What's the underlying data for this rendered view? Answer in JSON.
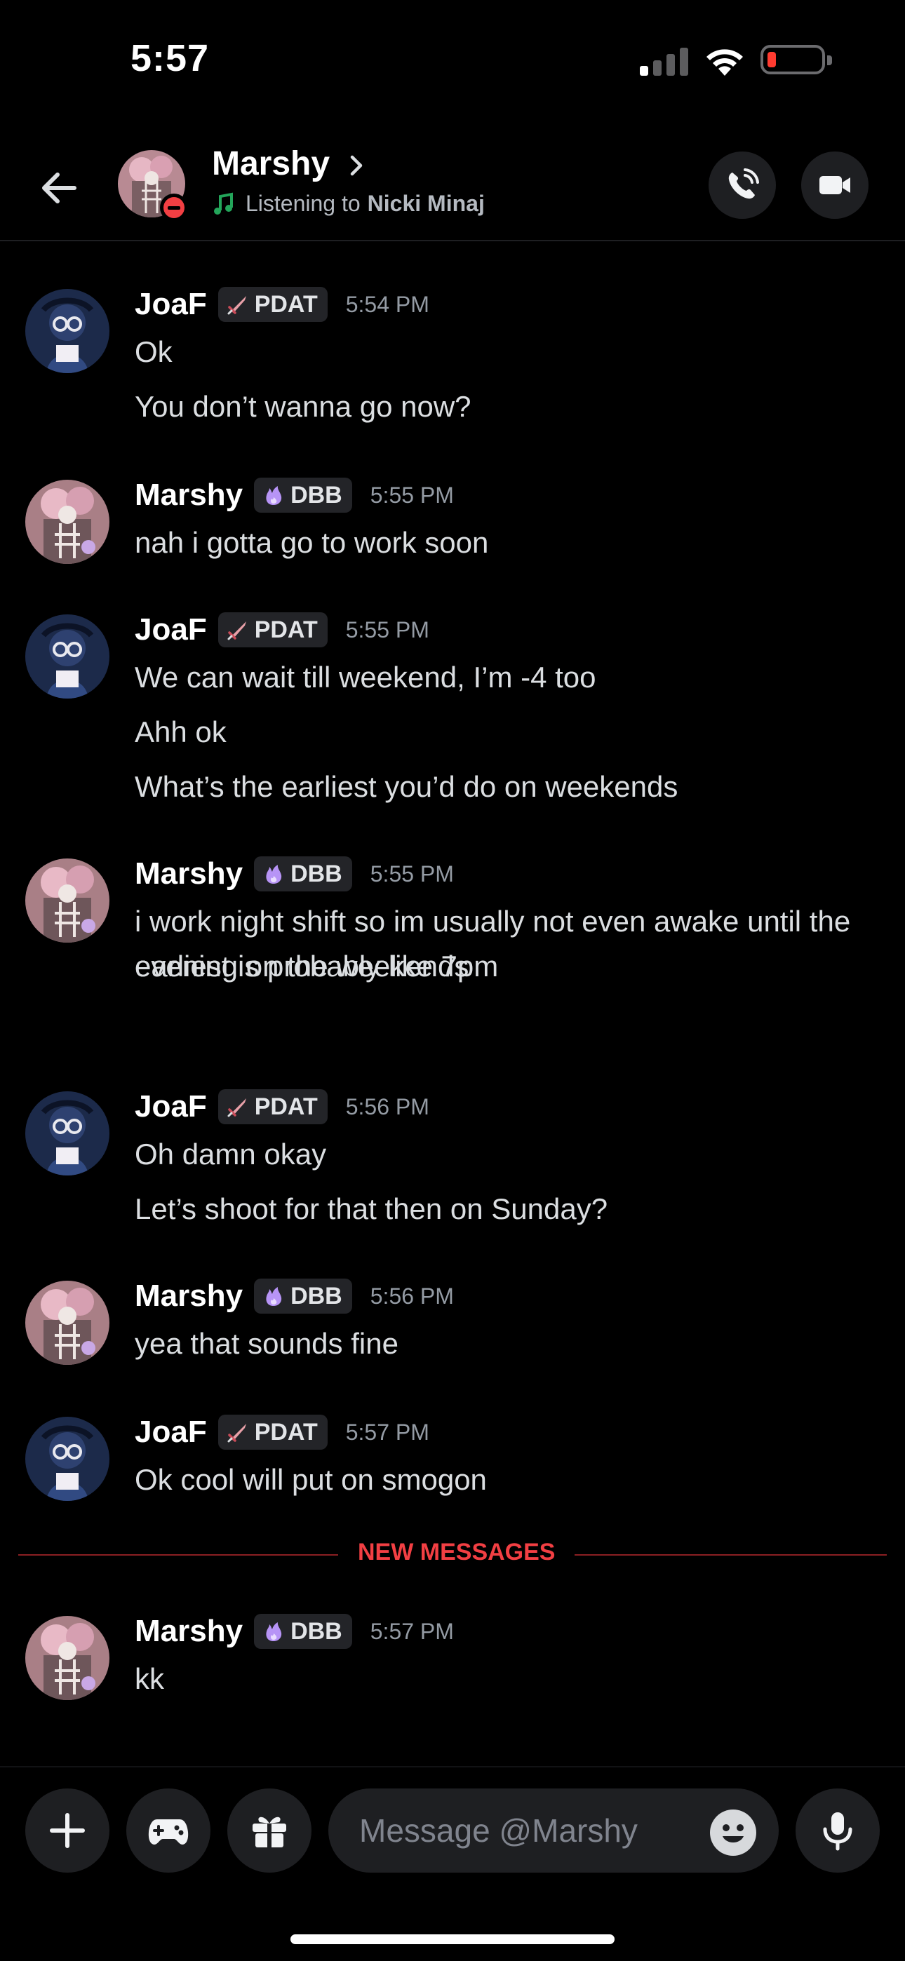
{
  "status_bar": {
    "time": "5:57",
    "signal_bars_active": 1,
    "battery_level_percent": 10
  },
  "header": {
    "name": "Marshy",
    "status_prefix": "Listening to",
    "status_artist": "Nicki Minaj"
  },
  "tags": {
    "joaf": "PDAT",
    "marshy": "DBB"
  },
  "messages": [
    {
      "author": "JoaF",
      "tag": "PDAT",
      "time": "5:54 PM",
      "lines": [
        "Ok",
        "You don’t wanna go now?"
      ]
    },
    {
      "author": "Marshy",
      "tag": "DBB",
      "time": "5:55 PM",
      "lines": [
        "nah i gotta go to work soon"
      ]
    },
    {
      "author": "JoaF",
      "tag": "PDAT",
      "time": "5:55 PM",
      "lines": [
        "We can wait till weekend, I’m -4 too",
        "Ahh ok",
        "What’s the earliest you’d do on weekends"
      ]
    },
    {
      "author": "Marshy",
      "tag": "DBB",
      "time": "5:55 PM",
      "lines": [
        "i work night shift so im usually not even awake until the evening on the weekends",
        "earliest is probably like 7pm"
      ]
    },
    {
      "author": "JoaF",
      "tag": "PDAT",
      "time": "5:56 PM",
      "lines": [
        "Oh damn okay",
        "Let’s shoot for that then on Sunday?"
      ]
    },
    {
      "author": "Marshy",
      "tag": "DBB",
      "time": "5:56 PM",
      "lines": [
        "yea that sounds fine"
      ]
    },
    {
      "author": "JoaF",
      "tag": "PDAT",
      "time": "5:57 PM",
      "lines": [
        "Ok cool will put on smogon"
      ]
    },
    {
      "author": "Marshy",
      "tag": "DBB",
      "time": "5:57 PM",
      "lines": [
        "kk"
      ]
    }
  ],
  "divider_label": "NEW MESSAGES",
  "composer": {
    "placeholder": "Message @Marshy"
  }
}
